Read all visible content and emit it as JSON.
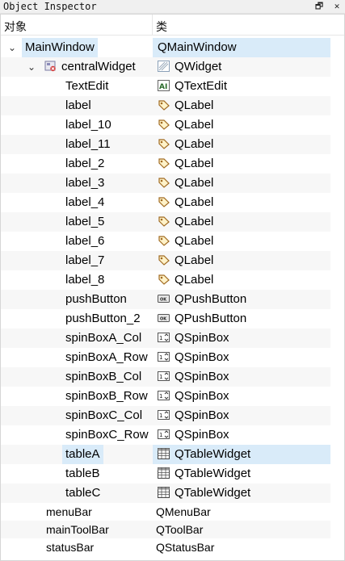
{
  "window": {
    "title": "Object Inspector",
    "float_icon": "float-icon",
    "close_icon": "close-icon",
    "float_glyph": "🗗",
    "close_glyph": "✕"
  },
  "header": {
    "col_object": "对象",
    "col_class": "类"
  },
  "rows": {
    "mainwindow": {
      "name": "MainWindow",
      "cls": "QMainWindow"
    },
    "centralwidget": {
      "name": "centralWidget",
      "cls": "QWidget"
    },
    "textedit": {
      "name": "TextEdit",
      "cls": "QTextEdit"
    },
    "label": {
      "name": "label",
      "cls": "QLabel"
    },
    "label_10": {
      "name": "label_10",
      "cls": "QLabel"
    },
    "label_11": {
      "name": "label_11",
      "cls": "QLabel"
    },
    "label_2": {
      "name": "label_2",
      "cls": "QLabel"
    },
    "label_3": {
      "name": "label_3",
      "cls": "QLabel"
    },
    "label_4": {
      "name": "label_4",
      "cls": "QLabel"
    },
    "label_5": {
      "name": "label_5",
      "cls": "QLabel"
    },
    "label_6": {
      "name": "label_6",
      "cls": "QLabel"
    },
    "label_7": {
      "name": "label_7",
      "cls": "QLabel"
    },
    "label_8": {
      "name": "label_8",
      "cls": "QLabel"
    },
    "pushbutton": {
      "name": "pushButton",
      "cls": "QPushButton"
    },
    "pushbutton_2": {
      "name": "pushButton_2",
      "cls": "QPushButton"
    },
    "spinboxa_col": {
      "name": "spinBoxA_Col",
      "cls": "QSpinBox"
    },
    "spinboxa_row": {
      "name": "spinBoxA_Row",
      "cls": "QSpinBox"
    },
    "spinboxb_col": {
      "name": "spinBoxB_Col",
      "cls": "QSpinBox"
    },
    "spinboxb_row": {
      "name": "spinBoxB_Row",
      "cls": "QSpinBox"
    },
    "spinboxc_col": {
      "name": "spinBoxC_Col",
      "cls": "QSpinBox"
    },
    "spinboxc_row": {
      "name": "spinBoxC_Row",
      "cls": "QSpinBox"
    },
    "tablea": {
      "name": "tableA",
      "cls": "QTableWidget"
    },
    "tableb": {
      "name": "tableB",
      "cls": "QTableWidget"
    },
    "tablec": {
      "name": "tableC",
      "cls": "QTableWidget"
    },
    "menubar": {
      "name": "menuBar",
      "cls": "QMenuBar"
    },
    "maintoolbar": {
      "name": "mainToolBar",
      "cls": "QToolBar"
    },
    "statusbar": {
      "name": "statusBar",
      "cls": "QStatusBar"
    }
  },
  "colors": {
    "selection": "#d9ebf9",
    "stripe": "#f7f7f7",
    "border": "#d6d6d6"
  }
}
